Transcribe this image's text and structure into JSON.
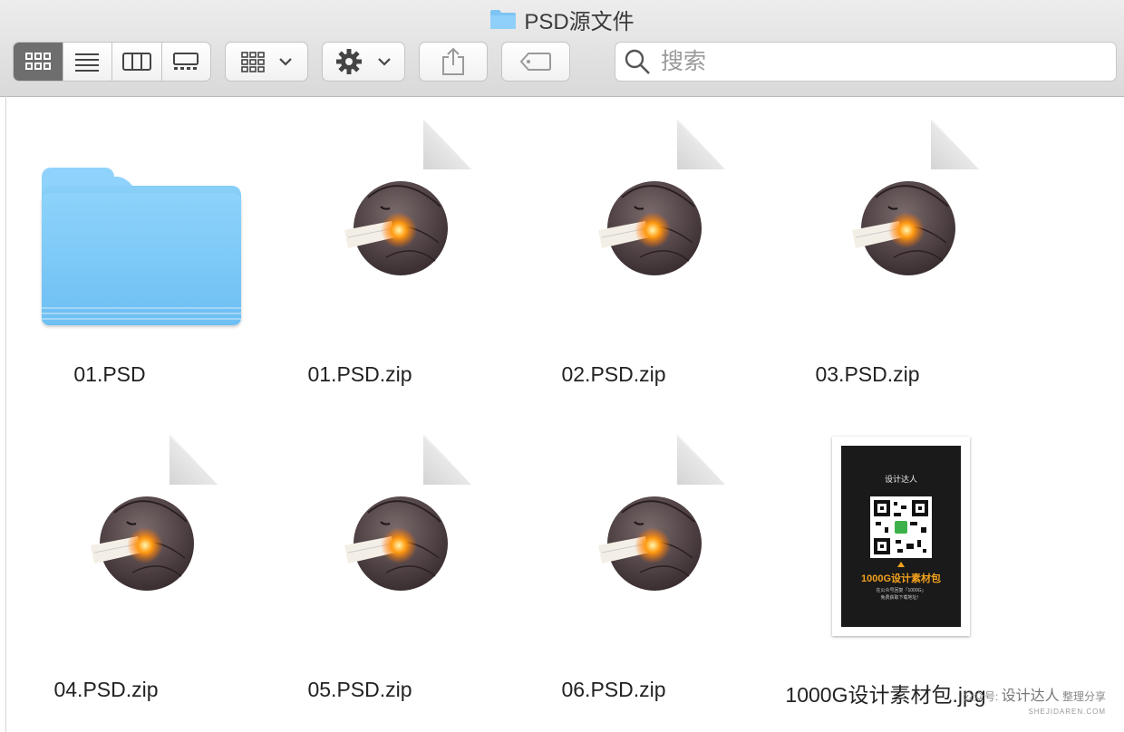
{
  "window": {
    "title": "PSD源文件"
  },
  "toolbar": {
    "view_buttons": [
      "icon-view",
      "list-view",
      "column-view",
      "gallery-view"
    ],
    "group_button_icon": "group-grid-icon",
    "action_button_icon": "gear-icon",
    "share_button_icon": "share-icon",
    "tag_button_icon": "tag-icon",
    "search_placeholder": "搜索"
  },
  "files": [
    {
      "name": "01.PSD",
      "kind": "folder"
    },
    {
      "name": "01.PSD.zip",
      "kind": "archive"
    },
    {
      "name": "02.PSD.zip",
      "kind": "archive"
    },
    {
      "name": "03.PSD.zip",
      "kind": "archive"
    },
    {
      "name": "04.PSD.zip",
      "kind": "archive"
    },
    {
      "name": "05.PSD.zip",
      "kind": "archive"
    },
    {
      "name": "06.PSD.zip",
      "kind": "archive"
    },
    {
      "name": "1000G设计素材包.jpg",
      "kind": "image"
    }
  ],
  "thumbnail": {
    "logo_text": "设计达人",
    "headline": "1000G设计素材包",
    "line1": "在公众号回复「1000G」",
    "line2": "免费获取下载地址！"
  },
  "watermark": {
    "prefix": "公众号:",
    "brand": "设计达人",
    "suffix": "整理分享",
    "url": "SHEJIDAREN.COM"
  },
  "colors": {
    "folder": "#7cc8f7",
    "selected_segment": "#6e6e6e"
  }
}
